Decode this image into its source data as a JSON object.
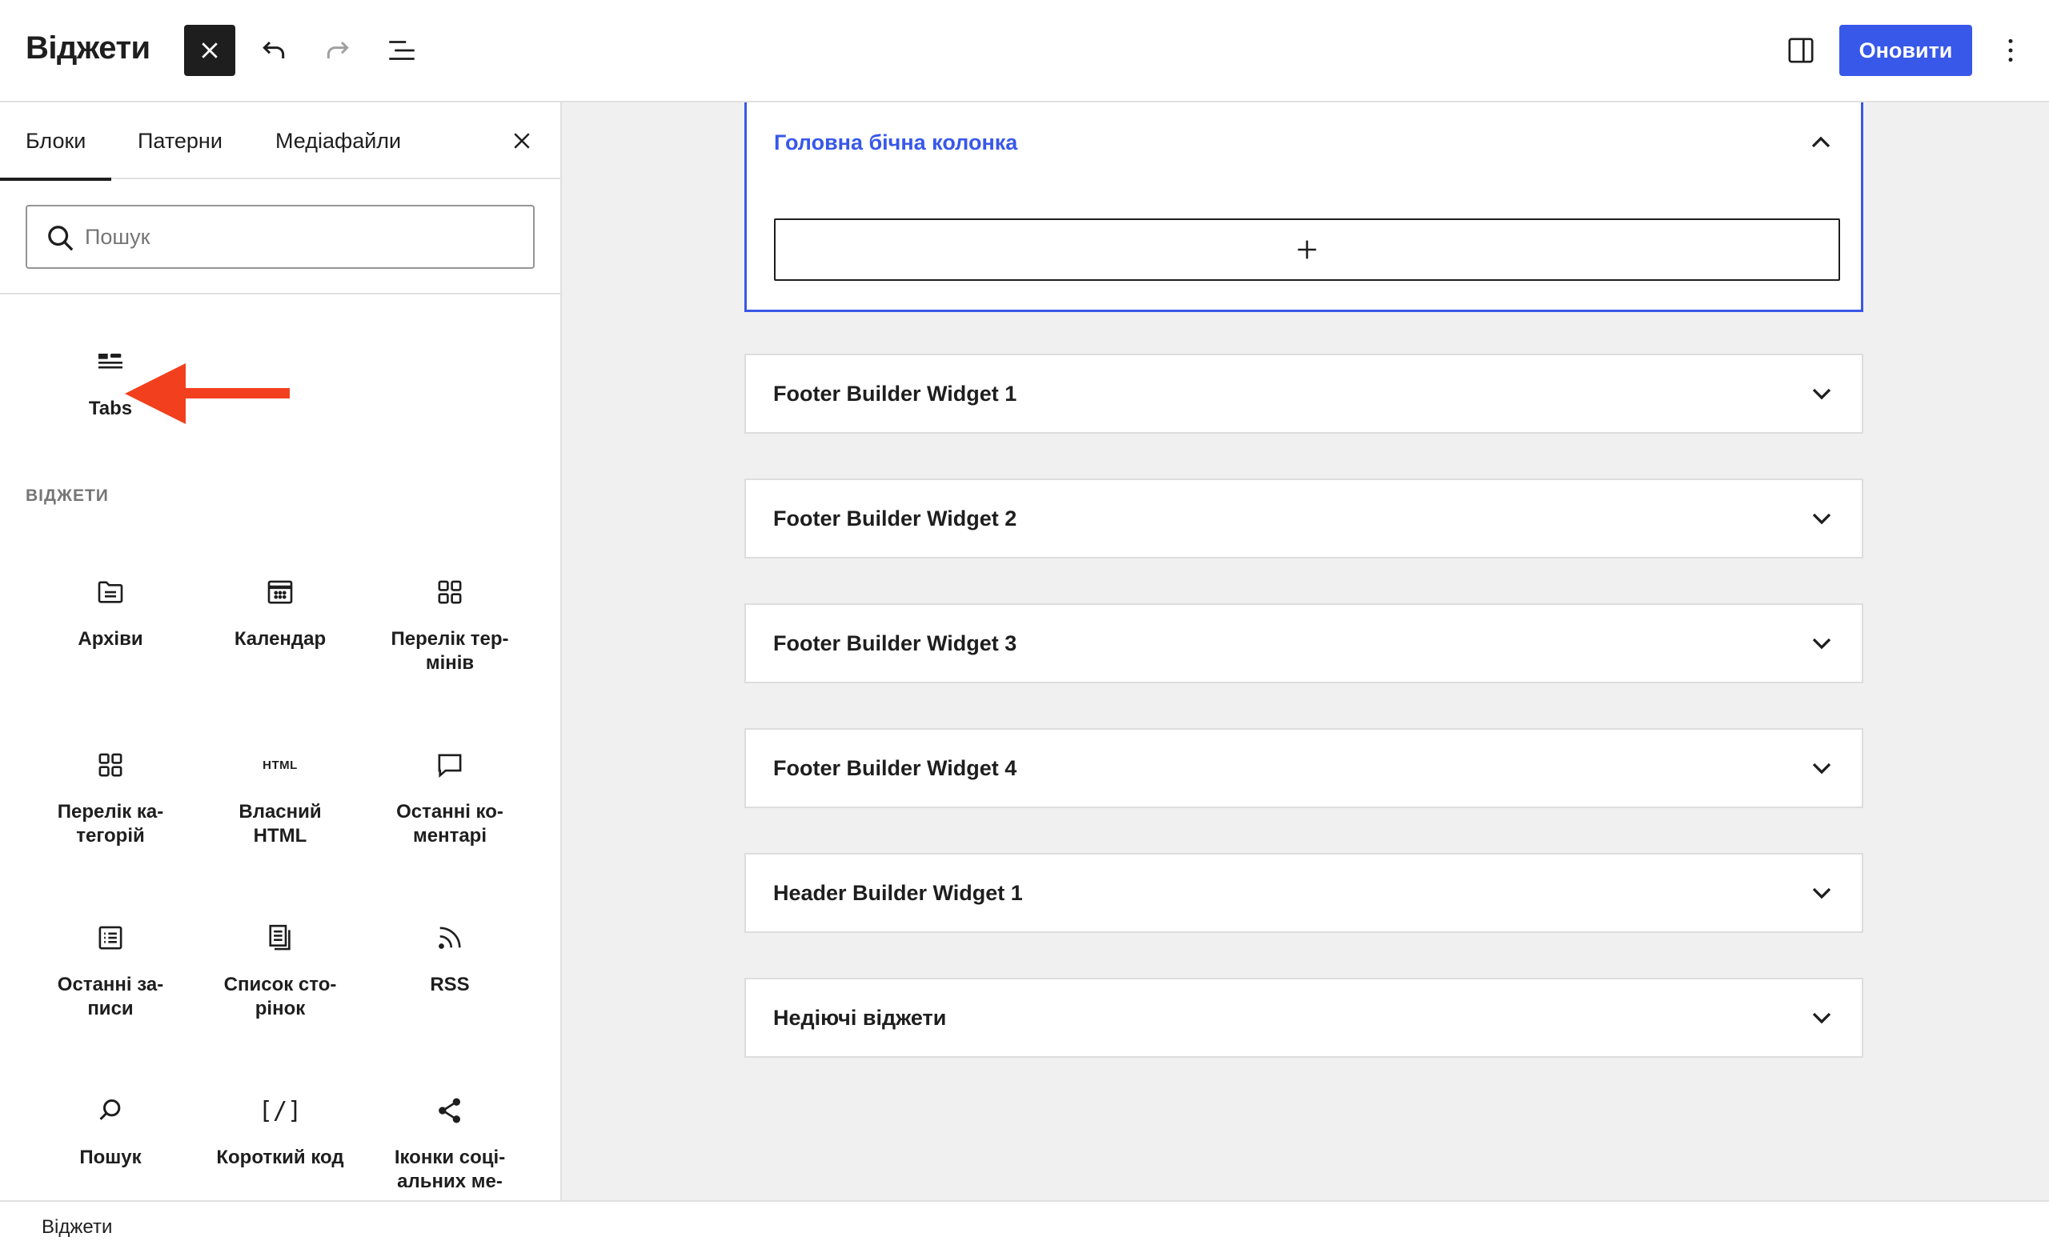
{
  "header": {
    "title": "Віджети",
    "update_label": "Оновити"
  },
  "inserter": {
    "tabs": [
      {
        "label": "Блоки"
      },
      {
        "label": "Патерни"
      },
      {
        "label": "Медіафайли"
      }
    ],
    "search_placeholder": "Пошук",
    "top_blocks": [
      {
        "label": "Tabs",
        "icon": "tabs-icon"
      }
    ],
    "section_title": "ВІДЖЕТИ",
    "widgets": [
      {
        "label": "Архіви",
        "icon": "archive-icon"
      },
      {
        "label": "Календар",
        "icon": "calendar-icon"
      },
      {
        "label": "Перелік тер-\nмінів",
        "icon": "terms-list-icon"
      },
      {
        "label": "Перелік ка-\nтегорій",
        "icon": "categories-icon"
      },
      {
        "label": "Власний\nHTML",
        "icon": "html-icon",
        "icon_text": "HTML"
      },
      {
        "label": "Останні ко-\nментарі",
        "icon": "comment-icon"
      },
      {
        "label": "Останні за-\nписи",
        "icon": "posts-list-icon"
      },
      {
        "label": "Список сто-\nрінок",
        "icon": "pages-list-icon"
      },
      {
        "label": "RSS",
        "icon": "rss-icon"
      },
      {
        "label": "Пошук",
        "icon": "search-icon"
      },
      {
        "label": "Короткий код",
        "icon": "shortcode-icon",
        "icon_text": "[/]"
      },
      {
        "label": "Іконки соці-\nальних ме-",
        "icon": "share-icon"
      }
    ]
  },
  "widget_areas": [
    {
      "title": "Головна бічна колонка",
      "expanded": true
    },
    {
      "title": "Footer Builder Widget 1",
      "expanded": false
    },
    {
      "title": "Footer Builder Widget 2",
      "expanded": false
    },
    {
      "title": "Footer Builder Widget 3",
      "expanded": false
    },
    {
      "title": "Footer Builder Widget 4",
      "expanded": false
    },
    {
      "title": "Header Builder Widget 1",
      "expanded": false
    },
    {
      "title": "Недіючі віджети",
      "expanded": false
    }
  ],
  "footer": {
    "breadcrumb": "Віджети"
  },
  "colors": {
    "accent": "#3858e9",
    "annotation_arrow": "#f2401f",
    "canvas_bg": "#f0f0f0"
  }
}
